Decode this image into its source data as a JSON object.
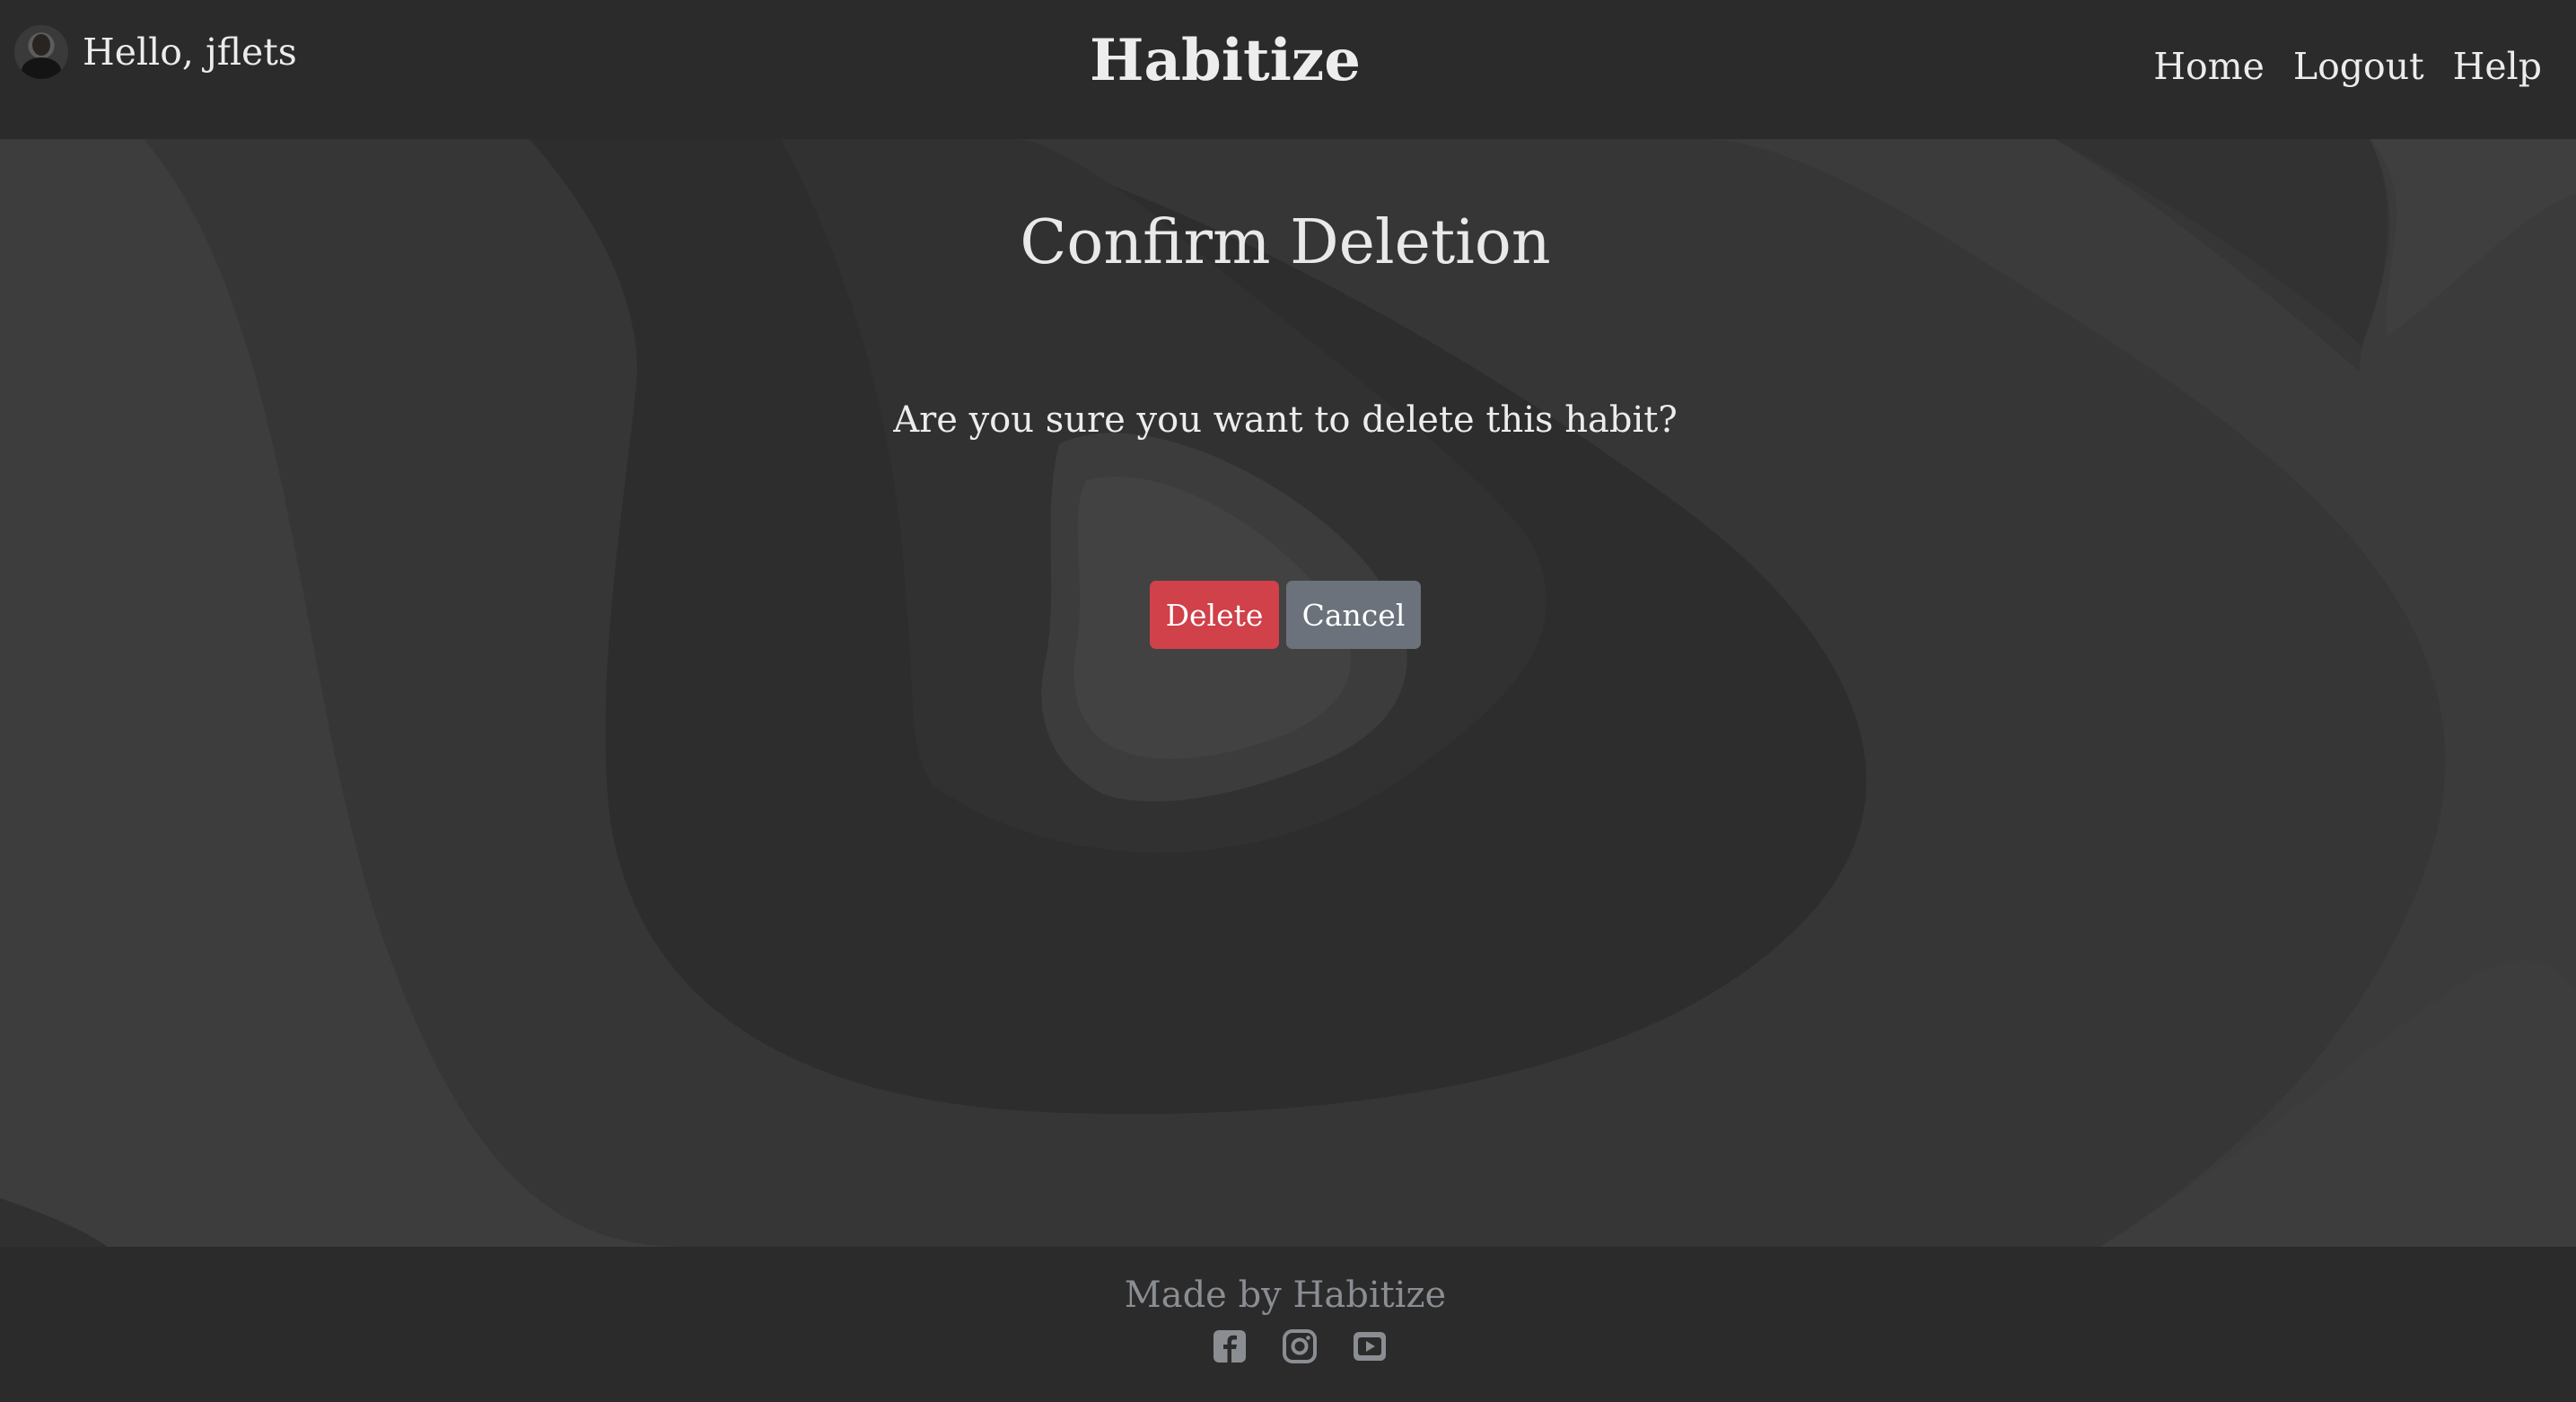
{
  "header": {
    "greeting": "Hello, jflets",
    "brand": "Habitize",
    "nav": {
      "home": "Home",
      "logout": "Logout",
      "help": "Help"
    }
  },
  "main": {
    "title": "Confirm Deletion",
    "question": "Are you sure you want to delete this habit?",
    "delete_label": "Delete",
    "cancel_label": "Cancel"
  },
  "footer": {
    "made_by": "Made by Habitize",
    "social_icons": [
      "facebook-icon",
      "instagram-icon",
      "youtube-icon"
    ]
  },
  "colors": {
    "bar_background": "#2b2b2b",
    "delete_button": "#d0414a",
    "cancel_button": "#6c727b",
    "footer_text": "#8a8d92"
  }
}
